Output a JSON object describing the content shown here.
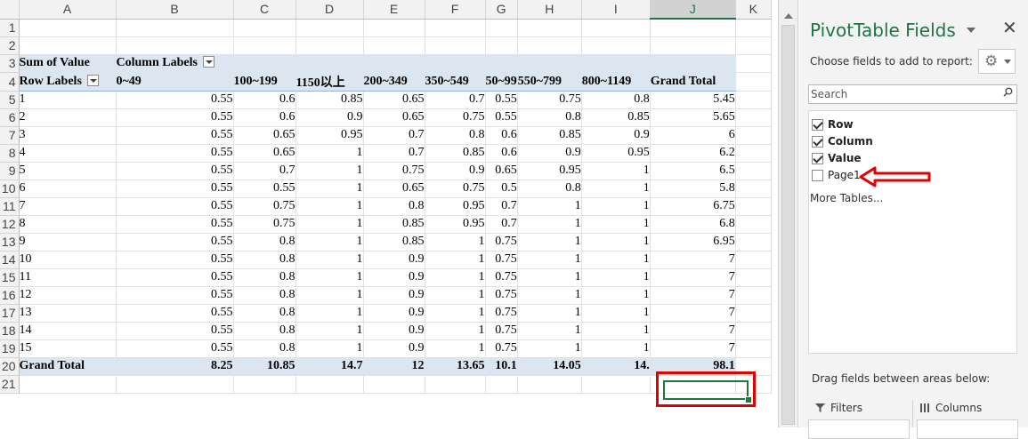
{
  "columns": [
    "A",
    "B",
    "C",
    "D",
    "E",
    "F",
    "G",
    "H",
    "I",
    "J",
    "K"
  ],
  "selected_column": "J",
  "row_numbers": [
    "1",
    "2",
    "3",
    "4",
    "5",
    "6",
    "7",
    "8",
    "9",
    "10",
    "11",
    "12",
    "13",
    "14",
    "15",
    "16",
    "17",
    "18",
    "19",
    "20",
    "21"
  ],
  "pivot": {
    "corner_label": "Sum of Value",
    "column_labels": "Column Labels",
    "row_labels": "Row Labels",
    "headers": [
      "0~49",
      "100~199",
      "1150以上",
      "200~349",
      "350~549",
      "50~99",
      "550~799",
      "800~1149",
      "Grand Total"
    ],
    "rows": [
      [
        "1",
        "0.55",
        "0.6",
        "0.85",
        "0.65",
        "0.7",
        "0.55",
        "0.75",
        "0.8",
        "5.45"
      ],
      [
        "2",
        "0.55",
        "0.6",
        "0.9",
        "0.65",
        "0.75",
        "0.55",
        "0.8",
        "0.85",
        "5.65"
      ],
      [
        "3",
        "0.55",
        "0.65",
        "0.95",
        "0.7",
        "0.8",
        "0.6",
        "0.85",
        "0.9",
        "6"
      ],
      [
        "4",
        "0.55",
        "0.65",
        "1",
        "0.7",
        "0.85",
        "0.6",
        "0.9",
        "0.95",
        "6.2"
      ],
      [
        "5",
        "0.55",
        "0.7",
        "1",
        "0.75",
        "0.9",
        "0.65",
        "0.95",
        "1",
        "6.5"
      ],
      [
        "6",
        "0.55",
        "0.55",
        "1",
        "0.65",
        "0.75",
        "0.5",
        "0.8",
        "1",
        "5.8"
      ],
      [
        "7",
        "0.55",
        "0.75",
        "1",
        "0.8",
        "0.95",
        "0.7",
        "1",
        "1",
        "6.75"
      ],
      [
        "8",
        "0.55",
        "0.75",
        "1",
        "0.85",
        "0.95",
        "0.7",
        "1",
        "1",
        "6.8"
      ],
      [
        "9",
        "0.55",
        "0.8",
        "1",
        "0.85",
        "1",
        "0.75",
        "1",
        "1",
        "6.95"
      ],
      [
        "10",
        "0.55",
        "0.8",
        "1",
        "0.9",
        "1",
        "0.75",
        "1",
        "1",
        "7"
      ],
      [
        "11",
        "0.55",
        "0.8",
        "1",
        "0.9",
        "1",
        "0.75",
        "1",
        "1",
        "7"
      ],
      [
        "12",
        "0.55",
        "0.8",
        "1",
        "0.9",
        "1",
        "0.75",
        "1",
        "1",
        "7"
      ],
      [
        "13",
        "0.55",
        "0.8",
        "1",
        "0.9",
        "1",
        "0.75",
        "1",
        "1",
        "7"
      ],
      [
        "14",
        "0.55",
        "0.8",
        "1",
        "0.9",
        "1",
        "0.75",
        "1",
        "1",
        "7"
      ],
      [
        "15",
        "0.55",
        "0.8",
        "1",
        "0.9",
        "1",
        "0.75",
        "1",
        "1",
        "7"
      ]
    ],
    "grand_total": [
      "Grand Total",
      "8.25",
      "10.85",
      "14.7",
      "12",
      "13.65",
      "10.1",
      "14.05",
      "14.",
      "98.1"
    ]
  },
  "pane": {
    "title": "PivotTable Fields",
    "close": "✕",
    "choose_label": "Choose fields to add to report:",
    "gear": "⚙",
    "search_placeholder": "Search",
    "fields": [
      {
        "label": "Row",
        "checked": true
      },
      {
        "label": "Column",
        "checked": true
      },
      {
        "label": "Value",
        "checked": true
      },
      {
        "label": "Page1",
        "checked": false
      }
    ],
    "more_tables": "More Tables...",
    "drag_label": "Drag fields between areas below:",
    "filters_label": "Filters",
    "columns_label": "Columns"
  },
  "colors": {
    "pivot_band": "#dce6f1",
    "accent_green": "#217346",
    "highlight_red": "#e00000"
  }
}
